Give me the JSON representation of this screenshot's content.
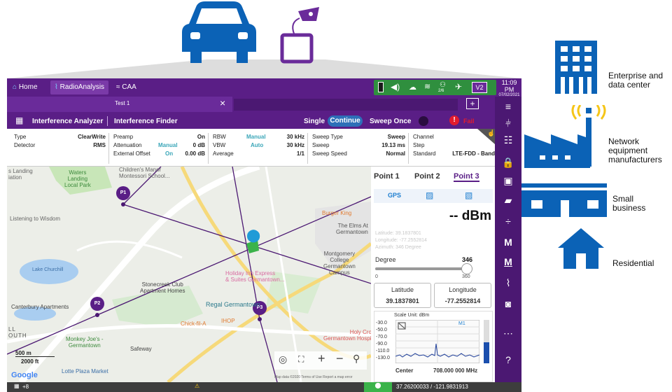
{
  "colors": {
    "brand_blue": "#0b62b6",
    "frame_purple": "#5a1e86",
    "status_green": "#2f8f3e",
    "alert_red": "#e21b2d",
    "teal": "#3aa6b8"
  },
  "topbar": {
    "home_label": "Home",
    "tab_active_label": "RadioAnalysis",
    "tab_caa_label": "CAA",
    "clock_time": "11:09 PM",
    "clock_date": "07/02/2021",
    "status_icons": [
      "battery-icon",
      "speaker-icon",
      "cloud-icon",
      "wifi-icon",
      "network-icon",
      "satellite-icon",
      "v2-icon"
    ],
    "sat_count": "2/6",
    "v2_label": "V2"
  },
  "test_tab": {
    "label": "Test 1",
    "close_glyph": "×",
    "add_glyph": "+"
  },
  "mode_bar": {
    "analyzer_label": "Interference Analyzer",
    "finder_label": "Interference Finder",
    "single_label": "Single",
    "continue_label": "Continue",
    "sweep_once_label": "Sweep Once",
    "fail_label": "Fail"
  },
  "params": {
    "type_k": "Type",
    "type_v": "ClearWrite",
    "detector_k": "Detector",
    "detector_v": "RMS",
    "preamp_k": "Preamp",
    "preamp_v": "On",
    "atten_k": "Attenuation",
    "atten_m": "Manual",
    "atten_v": "0 dB",
    "extoff_k": "External Offset",
    "extoff_m": "On",
    "extoff_v": "0.00 dB",
    "rbw_k": "RBW",
    "rbw_m": "Manual",
    "rbw_v": "30 kHz",
    "vbw_k": "VBW",
    "vbw_m": "Auto",
    "vbw_v": "30 kHz",
    "avg_k": "Average",
    "avg_v": "1/1",
    "sweeptype_k": "Sweep Type",
    "sweeptype_v": "Sweep",
    "sweep_k": "Sweep",
    "sweep_v": "19.13 ms",
    "sweepspeed_k": "Sweep Speed",
    "sweepspeed_v": "Normal",
    "channel_k": "Channel",
    "step_k": "Step",
    "standard_k": "Standard",
    "standard_v": "LTE-FDD - Band"
  },
  "map": {
    "labels": {
      "landing": "s Landing\niation",
      "waters": "Waters\nLanding\nLocal Park",
      "childrens": "Children's Manor\nMontessori School...",
      "listening": "Listening to Wisdom",
      "lake": "Lake Churchill",
      "stonecreek": "Stonecreek Club\nApartment Homes",
      "holiday": "Holiday Inn Express\n& Suites Germantown...",
      "regal": "Regal Germantown",
      "canterbury": "Canterbury Apartments",
      "burger": "Burger King",
      "elms": "The Elms At\nGermantown",
      "montgomery": "Montgomery\nCollege\nGermantown\nCampus",
      "chickfila": "Chick-fil-A",
      "ihop": "IHOP",
      "safeway": "Safeway",
      "monkey": "Monkey Joe's -\nGermantown",
      "lotte": "Lotte Plaza Market",
      "holycross": "Holy Cross\nGermantown Hospital",
      "south": "LL\nOUTH",
      "google": "Google",
      "footer": "Map data ©2020   Terms of Use   Report a map error"
    },
    "scale_m": "500 m",
    "scale_ft": "2000 ft",
    "points": [
      "P1",
      "P2",
      "P3"
    ]
  },
  "panel": {
    "tabs": [
      "Point 1",
      "Point 2",
      "Point 3"
    ],
    "gps_label": "GPS",
    "power_value": "-- dBm",
    "latitude_line": "Latitude: 39.1837801",
    "longitude_line": "Longitude: -77.2552814",
    "azimuth_line": "Azimuth: 346 Degree",
    "degree_label": "Degree",
    "degree_value": "346",
    "slider_min": "0",
    "slider_max": "360",
    "slider_fraction": 0.961,
    "lat_label": "Latitude",
    "lon_label": "Longitude",
    "lat_value": "39.1837801",
    "lon_value": "-77.2552814",
    "scale_unit": "Scale Unit: dBm",
    "y_ticks": [
      "-30.0",
      "-50.0",
      "-70.0",
      "-90.0",
      "-110.0",
      "-130.0"
    ],
    "marker_label": "M1",
    "center_label": "Center",
    "center_value": "708.000 000 MHz"
  },
  "bottombar": {
    "left_count": "+8",
    "coords": "37.26200033 / -121.9831913"
  },
  "right_legend": {
    "enterprise": "Enterprise and\ndata center",
    "network": "Network\nequipment\nmanufacturers",
    "small": "Small\nbusiness",
    "residential": "Residential"
  }
}
